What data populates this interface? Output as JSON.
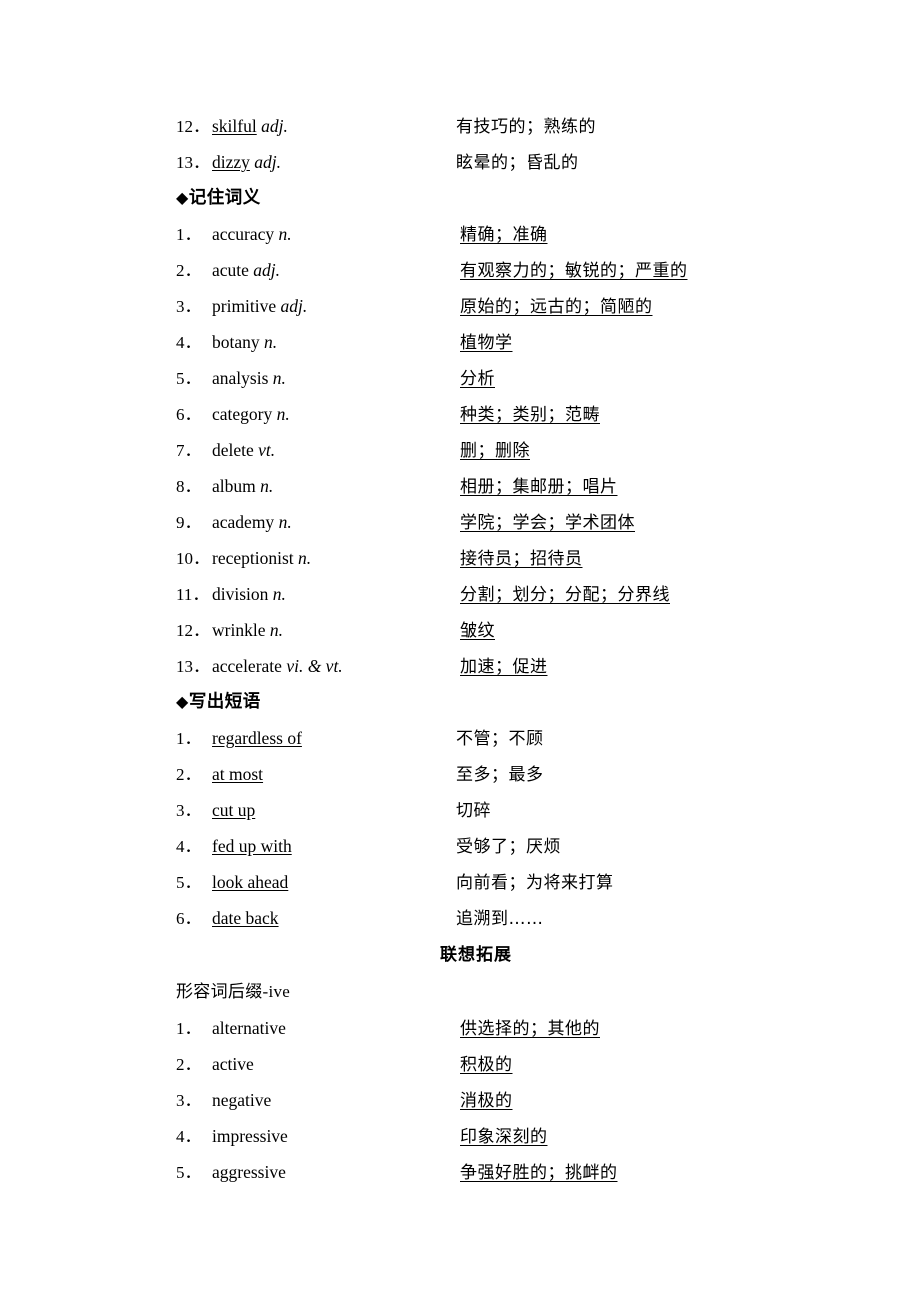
{
  "page": {
    "background_color": "#ffffff",
    "text_color": "#000000"
  },
  "top_list": {
    "rows": [
      {
        "num": "12．",
        "term": "skilful",
        "pos": "adj.",
        "term_underlined": true,
        "meaning": "有技巧的；熟练的",
        "meaning_underlined": false
      },
      {
        "num": "13．",
        "term": "dizzy",
        "pos": "adj.",
        "term_underlined": true,
        "meaning": "眩晕的；昏乱的",
        "meaning_underlined": false
      }
    ]
  },
  "section_remember": {
    "diamond": "◆",
    "title": "记住词义",
    "rows": [
      {
        "num": "1．",
        "term": "accuracy",
        "pos": "n.",
        "term_underlined": false,
        "meaning": "精确；准确",
        "meaning_underlined": true
      },
      {
        "num": "2．",
        "term": "acute",
        "pos": "adj.",
        "term_underlined": false,
        "meaning": "有观察力的；敏锐的；严重的",
        "meaning_underlined": true
      },
      {
        "num": "3．",
        "term": "primitive",
        "pos": "adj.",
        "term_underlined": false,
        "meaning": "原始的；远古的；简陋的",
        "meaning_underlined": true
      },
      {
        "num": "4．",
        "term": "botany",
        "pos": "n.",
        "term_underlined": false,
        "meaning": "植物学",
        "meaning_underlined": true
      },
      {
        "num": "5．",
        "term": "analysis",
        "pos": "n.",
        "term_underlined": false,
        "meaning": "分析",
        "meaning_underlined": true
      },
      {
        "num": "6．",
        "term": "category",
        "pos": "n.",
        "term_underlined": false,
        "meaning": "种类；类别；范畴",
        "meaning_underlined": true
      },
      {
        "num": "7．",
        "term": "delete",
        "pos": "vt.",
        "term_underlined": false,
        "meaning": "删；删除",
        "meaning_underlined": true
      },
      {
        "num": "8．",
        "term": "album",
        "pos": "n.",
        "term_underlined": false,
        "meaning": "相册；集邮册；唱片",
        "meaning_underlined": true
      },
      {
        "num": "9．",
        "term": "academy",
        "pos": "n.",
        "term_underlined": false,
        "meaning": "学院；学会；学术团体",
        "meaning_underlined": true
      },
      {
        "num": "10．",
        "term": "receptionist",
        "pos": "n.",
        "term_underlined": false,
        "meaning": "接待员；招待员",
        "meaning_underlined": true
      },
      {
        "num": "11．",
        "term": "division",
        "pos": "n.",
        "term_underlined": false,
        "meaning": "分割；划分；分配；分界线",
        "meaning_underlined": true
      },
      {
        "num": "12．",
        "term": "wrinkle",
        "pos": "n.",
        "term_underlined": false,
        "meaning": "皱纹",
        "meaning_underlined": true
      },
      {
        "num": "13．",
        "term": "accelerate",
        "pos": "vi. & vt.",
        "term_underlined": false,
        "meaning": "加速；促进",
        "meaning_underlined": true
      }
    ]
  },
  "section_phrases": {
    "diamond": "◆",
    "title": "写出短语",
    "rows": [
      {
        "num": "1．",
        "term": "regardless of",
        "pos": "",
        "term_underlined": true,
        "meaning": "不管；不顾",
        "meaning_underlined": false
      },
      {
        "num": "2．",
        "term": "at most",
        "pos": "",
        "term_underlined": true,
        "meaning": "至多；最多",
        "meaning_underlined": false
      },
      {
        "num": "3．",
        "term": "cut up",
        "pos": "",
        "term_underlined": true,
        "meaning": "切碎",
        "meaning_underlined": false
      },
      {
        "num": "4．",
        "term": "fed up with",
        "pos": "",
        "term_underlined": true,
        "meaning": "受够了；厌烦",
        "meaning_underlined": false
      },
      {
        "num": "5．",
        "term": "look ahead",
        "pos": "",
        "term_underlined": true,
        "meaning": "向前看；为将来打算",
        "meaning_underlined": false
      },
      {
        "num": "6．",
        "term": "date back",
        "pos": "",
        "term_underlined": true,
        "meaning": "追溯到……",
        "meaning_underlined": false
      }
    ]
  },
  "section_extension": {
    "title": "联想拓展",
    "sub_title_cn": "形容词后缀",
    "sub_title_suffix": "-ive",
    "rows": [
      {
        "num": "1．",
        "term": "alternative",
        "pos": "",
        "term_underlined": false,
        "meaning": "供选择的；其他的",
        "meaning_underlined": true
      },
      {
        "num": "2．",
        "term": "active",
        "pos": "",
        "term_underlined": false,
        "meaning": "积极的",
        "meaning_underlined": true
      },
      {
        "num": "3．",
        "term": "negative",
        "pos": "",
        "term_underlined": false,
        "meaning": "消极的",
        "meaning_underlined": true
      },
      {
        "num": "4．",
        "term": "impressive",
        "pos": "",
        "term_underlined": false,
        "meaning": "印象深刻的",
        "meaning_underlined": true
      },
      {
        "num": "5．",
        "term": "aggressive",
        "pos": "",
        "term_underlined": false,
        "meaning": "争强好胜的；挑衅的",
        "meaning_underlined": true
      }
    ]
  }
}
